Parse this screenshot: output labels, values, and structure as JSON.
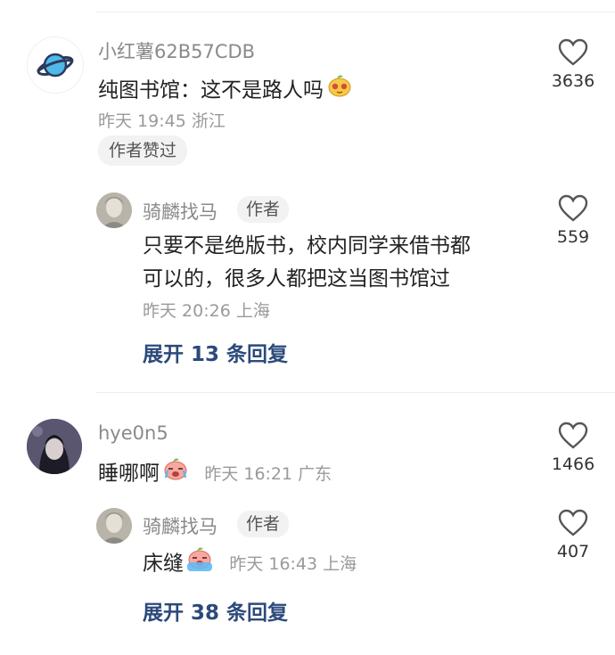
{
  "comments": [
    {
      "username": "小红薯62B57CDB",
      "text": "纯图书馆：这不是路人吗",
      "emoji": "crying-face-emoji",
      "time_location": "昨天 19:45 浙江",
      "badge": "作者赞过",
      "likes": "3636",
      "avatar": "planet-icon",
      "reply": {
        "username": "骑麟找马",
        "author_tag": "作者",
        "text_line1": "只要不是绝版书，校内同学来借书都",
        "text_line2": "可以的，很多人都把这当图书馆过",
        "time_location": "昨天 20:26 上海",
        "likes": "559"
      },
      "expand_label": "展开 13 条回复"
    },
    {
      "username": "hye0n5",
      "text": "睡哪啊",
      "emoji": "crying-face-emoji",
      "time_location": "昨天 16:21 广东",
      "likes": "1466",
      "reply": {
        "username": "骑麟找马",
        "author_tag": "作者",
        "text": "床缝",
        "emoji": "sobbing-face-emoji",
        "time_location": "昨天 16:43 上海",
        "likes": "407"
      },
      "expand_label": "展开 38 条回复"
    }
  ],
  "colors": {
    "expand_link": "#2c4a7a",
    "username": "#8a8a8a",
    "meta": "#9a9a9a"
  }
}
